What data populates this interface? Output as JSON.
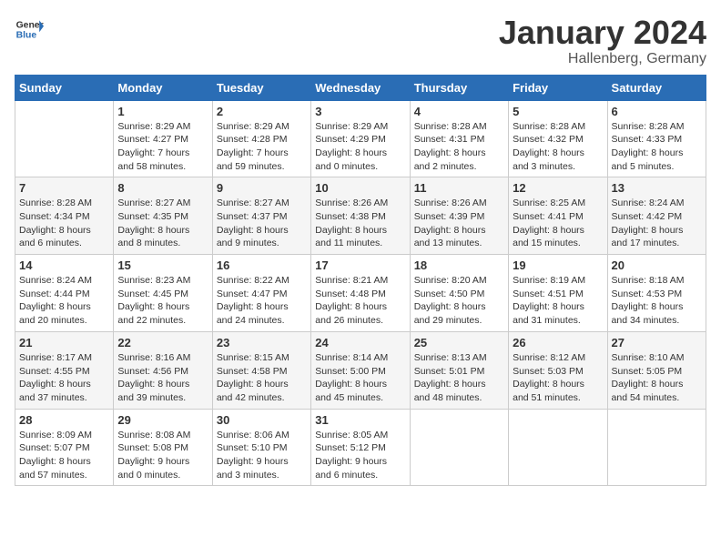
{
  "header": {
    "logo_general": "General",
    "logo_blue": "Blue",
    "month": "January 2024",
    "location": "Hallenberg, Germany"
  },
  "days_of_week": [
    "Sunday",
    "Monday",
    "Tuesday",
    "Wednesday",
    "Thursday",
    "Friday",
    "Saturday"
  ],
  "weeks": [
    [
      {
        "day": "",
        "content": ""
      },
      {
        "day": "1",
        "content": "Sunrise: 8:29 AM\nSunset: 4:27 PM\nDaylight: 7 hours\nand 58 minutes."
      },
      {
        "day": "2",
        "content": "Sunrise: 8:29 AM\nSunset: 4:28 PM\nDaylight: 7 hours\nand 59 minutes."
      },
      {
        "day": "3",
        "content": "Sunrise: 8:29 AM\nSunset: 4:29 PM\nDaylight: 8 hours\nand 0 minutes."
      },
      {
        "day": "4",
        "content": "Sunrise: 8:28 AM\nSunset: 4:31 PM\nDaylight: 8 hours\nand 2 minutes."
      },
      {
        "day": "5",
        "content": "Sunrise: 8:28 AM\nSunset: 4:32 PM\nDaylight: 8 hours\nand 3 minutes."
      },
      {
        "day": "6",
        "content": "Sunrise: 8:28 AM\nSunset: 4:33 PM\nDaylight: 8 hours\nand 5 minutes."
      }
    ],
    [
      {
        "day": "7",
        "content": "Sunrise: 8:28 AM\nSunset: 4:34 PM\nDaylight: 8 hours\nand 6 minutes."
      },
      {
        "day": "8",
        "content": "Sunrise: 8:27 AM\nSunset: 4:35 PM\nDaylight: 8 hours\nand 8 minutes."
      },
      {
        "day": "9",
        "content": "Sunrise: 8:27 AM\nSunset: 4:37 PM\nDaylight: 8 hours\nand 9 minutes."
      },
      {
        "day": "10",
        "content": "Sunrise: 8:26 AM\nSunset: 4:38 PM\nDaylight: 8 hours\nand 11 minutes."
      },
      {
        "day": "11",
        "content": "Sunrise: 8:26 AM\nSunset: 4:39 PM\nDaylight: 8 hours\nand 13 minutes."
      },
      {
        "day": "12",
        "content": "Sunrise: 8:25 AM\nSunset: 4:41 PM\nDaylight: 8 hours\nand 15 minutes."
      },
      {
        "day": "13",
        "content": "Sunrise: 8:24 AM\nSunset: 4:42 PM\nDaylight: 8 hours\nand 17 minutes."
      }
    ],
    [
      {
        "day": "14",
        "content": "Sunrise: 8:24 AM\nSunset: 4:44 PM\nDaylight: 8 hours\nand 20 minutes."
      },
      {
        "day": "15",
        "content": "Sunrise: 8:23 AM\nSunset: 4:45 PM\nDaylight: 8 hours\nand 22 minutes."
      },
      {
        "day": "16",
        "content": "Sunrise: 8:22 AM\nSunset: 4:47 PM\nDaylight: 8 hours\nand 24 minutes."
      },
      {
        "day": "17",
        "content": "Sunrise: 8:21 AM\nSunset: 4:48 PM\nDaylight: 8 hours\nand 26 minutes."
      },
      {
        "day": "18",
        "content": "Sunrise: 8:20 AM\nSunset: 4:50 PM\nDaylight: 8 hours\nand 29 minutes."
      },
      {
        "day": "19",
        "content": "Sunrise: 8:19 AM\nSunset: 4:51 PM\nDaylight: 8 hours\nand 31 minutes."
      },
      {
        "day": "20",
        "content": "Sunrise: 8:18 AM\nSunset: 4:53 PM\nDaylight: 8 hours\nand 34 minutes."
      }
    ],
    [
      {
        "day": "21",
        "content": "Sunrise: 8:17 AM\nSunset: 4:55 PM\nDaylight: 8 hours\nand 37 minutes."
      },
      {
        "day": "22",
        "content": "Sunrise: 8:16 AM\nSunset: 4:56 PM\nDaylight: 8 hours\nand 39 minutes."
      },
      {
        "day": "23",
        "content": "Sunrise: 8:15 AM\nSunset: 4:58 PM\nDaylight: 8 hours\nand 42 minutes."
      },
      {
        "day": "24",
        "content": "Sunrise: 8:14 AM\nSunset: 5:00 PM\nDaylight: 8 hours\nand 45 minutes."
      },
      {
        "day": "25",
        "content": "Sunrise: 8:13 AM\nSunset: 5:01 PM\nDaylight: 8 hours\nand 48 minutes."
      },
      {
        "day": "26",
        "content": "Sunrise: 8:12 AM\nSunset: 5:03 PM\nDaylight: 8 hours\nand 51 minutes."
      },
      {
        "day": "27",
        "content": "Sunrise: 8:10 AM\nSunset: 5:05 PM\nDaylight: 8 hours\nand 54 minutes."
      }
    ],
    [
      {
        "day": "28",
        "content": "Sunrise: 8:09 AM\nSunset: 5:07 PM\nDaylight: 8 hours\nand 57 minutes."
      },
      {
        "day": "29",
        "content": "Sunrise: 8:08 AM\nSunset: 5:08 PM\nDaylight: 9 hours\nand 0 minutes."
      },
      {
        "day": "30",
        "content": "Sunrise: 8:06 AM\nSunset: 5:10 PM\nDaylight: 9 hours\nand 3 minutes."
      },
      {
        "day": "31",
        "content": "Sunrise: 8:05 AM\nSunset: 5:12 PM\nDaylight: 9 hours\nand 6 minutes."
      },
      {
        "day": "",
        "content": ""
      },
      {
        "day": "",
        "content": ""
      },
      {
        "day": "",
        "content": ""
      }
    ]
  ]
}
